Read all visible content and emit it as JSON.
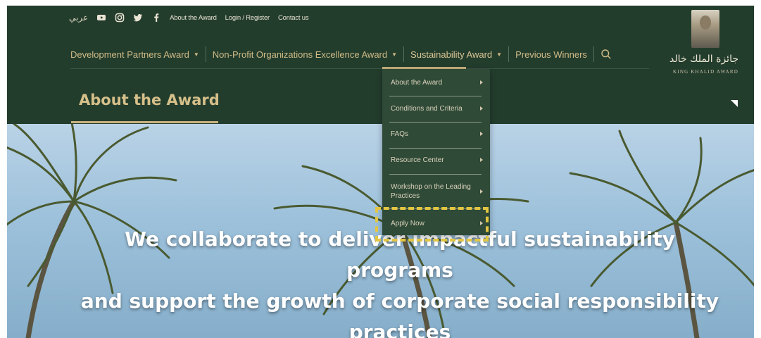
{
  "topbar": {
    "lang": "عربي",
    "social": [
      {
        "icon": "youtube-icon"
      },
      {
        "icon": "instagram-icon"
      },
      {
        "icon": "twitter-icon"
      },
      {
        "icon": "facebook-icon"
      }
    ],
    "links": [
      "About the Award",
      "Login / Register",
      "Contact us"
    ]
  },
  "nav": {
    "items": [
      {
        "label": "Development Partners Award",
        "dropdown": true
      },
      {
        "label": "Non-Profit Organizations Excellence Award",
        "dropdown": true
      },
      {
        "label": "Sustainability Award",
        "dropdown": true,
        "active": true
      },
      {
        "label": "Previous Winners",
        "dropdown": false
      }
    ],
    "search_icon": "search-icon"
  },
  "logo": {
    "arabic": "جائزة الملك خالد",
    "english": "KING KHALID AWARD"
  },
  "page": {
    "title": "About the Award"
  },
  "dropdown": {
    "items": [
      "About the Award",
      "Conditions and Criteria",
      "FAQs",
      "Resource Center",
      "Workshop on the Leading Practices",
      "Apply Now"
    ]
  },
  "hero": {
    "line1": "We collaborate to deliver impactful sustainability programs",
    "line2": "and support the growth of corporate social responsibility",
    "line3": "practices"
  },
  "colors": {
    "header_bg": "#233d2d",
    "gold": "#d0bb86",
    "dropdown_bg": "#2f4a37",
    "highlight": "#e2c542"
  }
}
